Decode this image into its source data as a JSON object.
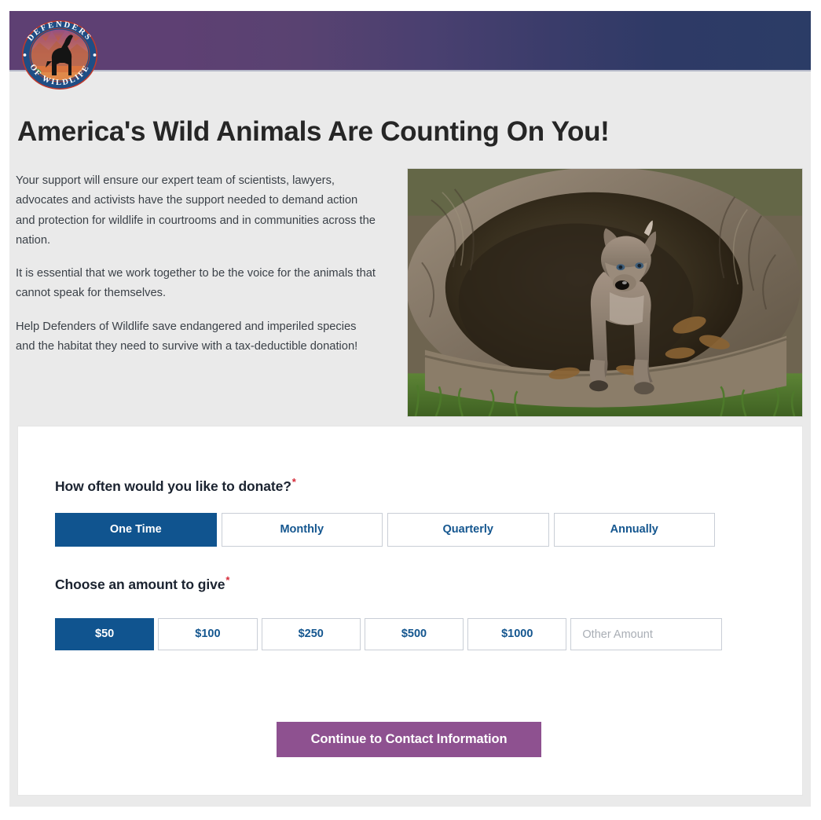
{
  "brand": {
    "logo_icon": "defenders-of-wildlife-wolf-logo",
    "name_top": "DEFENDERS",
    "name_bottom": "OF WILDLIFE",
    "header_gradient_start": "#5E4073",
    "header_gradient_end": "#2B3C66"
  },
  "hero": {
    "title": "America's Wild Animals Are Counting On You!",
    "paragraphs": [
      "Your support will ensure our expert team of scientists, lawyers, advocates and activists have the support needed to demand action and protection for wildlife in courtrooms and in communities across the nation.",
      "It is essential that we work together to be the voice for the animals that cannot speak for themselves.",
      "Help Defenders of Wildlife save endangered and imperiled species and the habitat they need to survive with a tax-deductible donation!"
    ],
    "image_alt": "wolf-pup-in-hollow-log-photo"
  },
  "form": {
    "frequency": {
      "label": "How often would you like to donate?",
      "required_marker": "*",
      "selected": "One Time",
      "options": [
        {
          "label": "One Time",
          "selected": true
        },
        {
          "label": "Monthly",
          "selected": false
        },
        {
          "label": "Quarterly",
          "selected": false
        },
        {
          "label": "Annually",
          "selected": false
        }
      ]
    },
    "amount": {
      "label": "Choose an amount to give",
      "required_marker": "*",
      "selected": "$50",
      "options": [
        {
          "label": "$50",
          "selected": true
        },
        {
          "label": "$100",
          "selected": false
        },
        {
          "label": "$250",
          "selected": false
        },
        {
          "label": "$500",
          "selected": false
        },
        {
          "label": "$1000",
          "selected": false
        }
      ],
      "other": {
        "placeholder": "Other Amount",
        "value": ""
      }
    },
    "submit": {
      "label": "Continue to Contact Information",
      "color": "#8E5190"
    }
  },
  "colors": {
    "selected_blue": "#10548F",
    "option_text_blue": "#14568F",
    "required_red": "#D62B3A",
    "page_background": "#EAEAEA",
    "card_background": "#FFFFFF"
  }
}
